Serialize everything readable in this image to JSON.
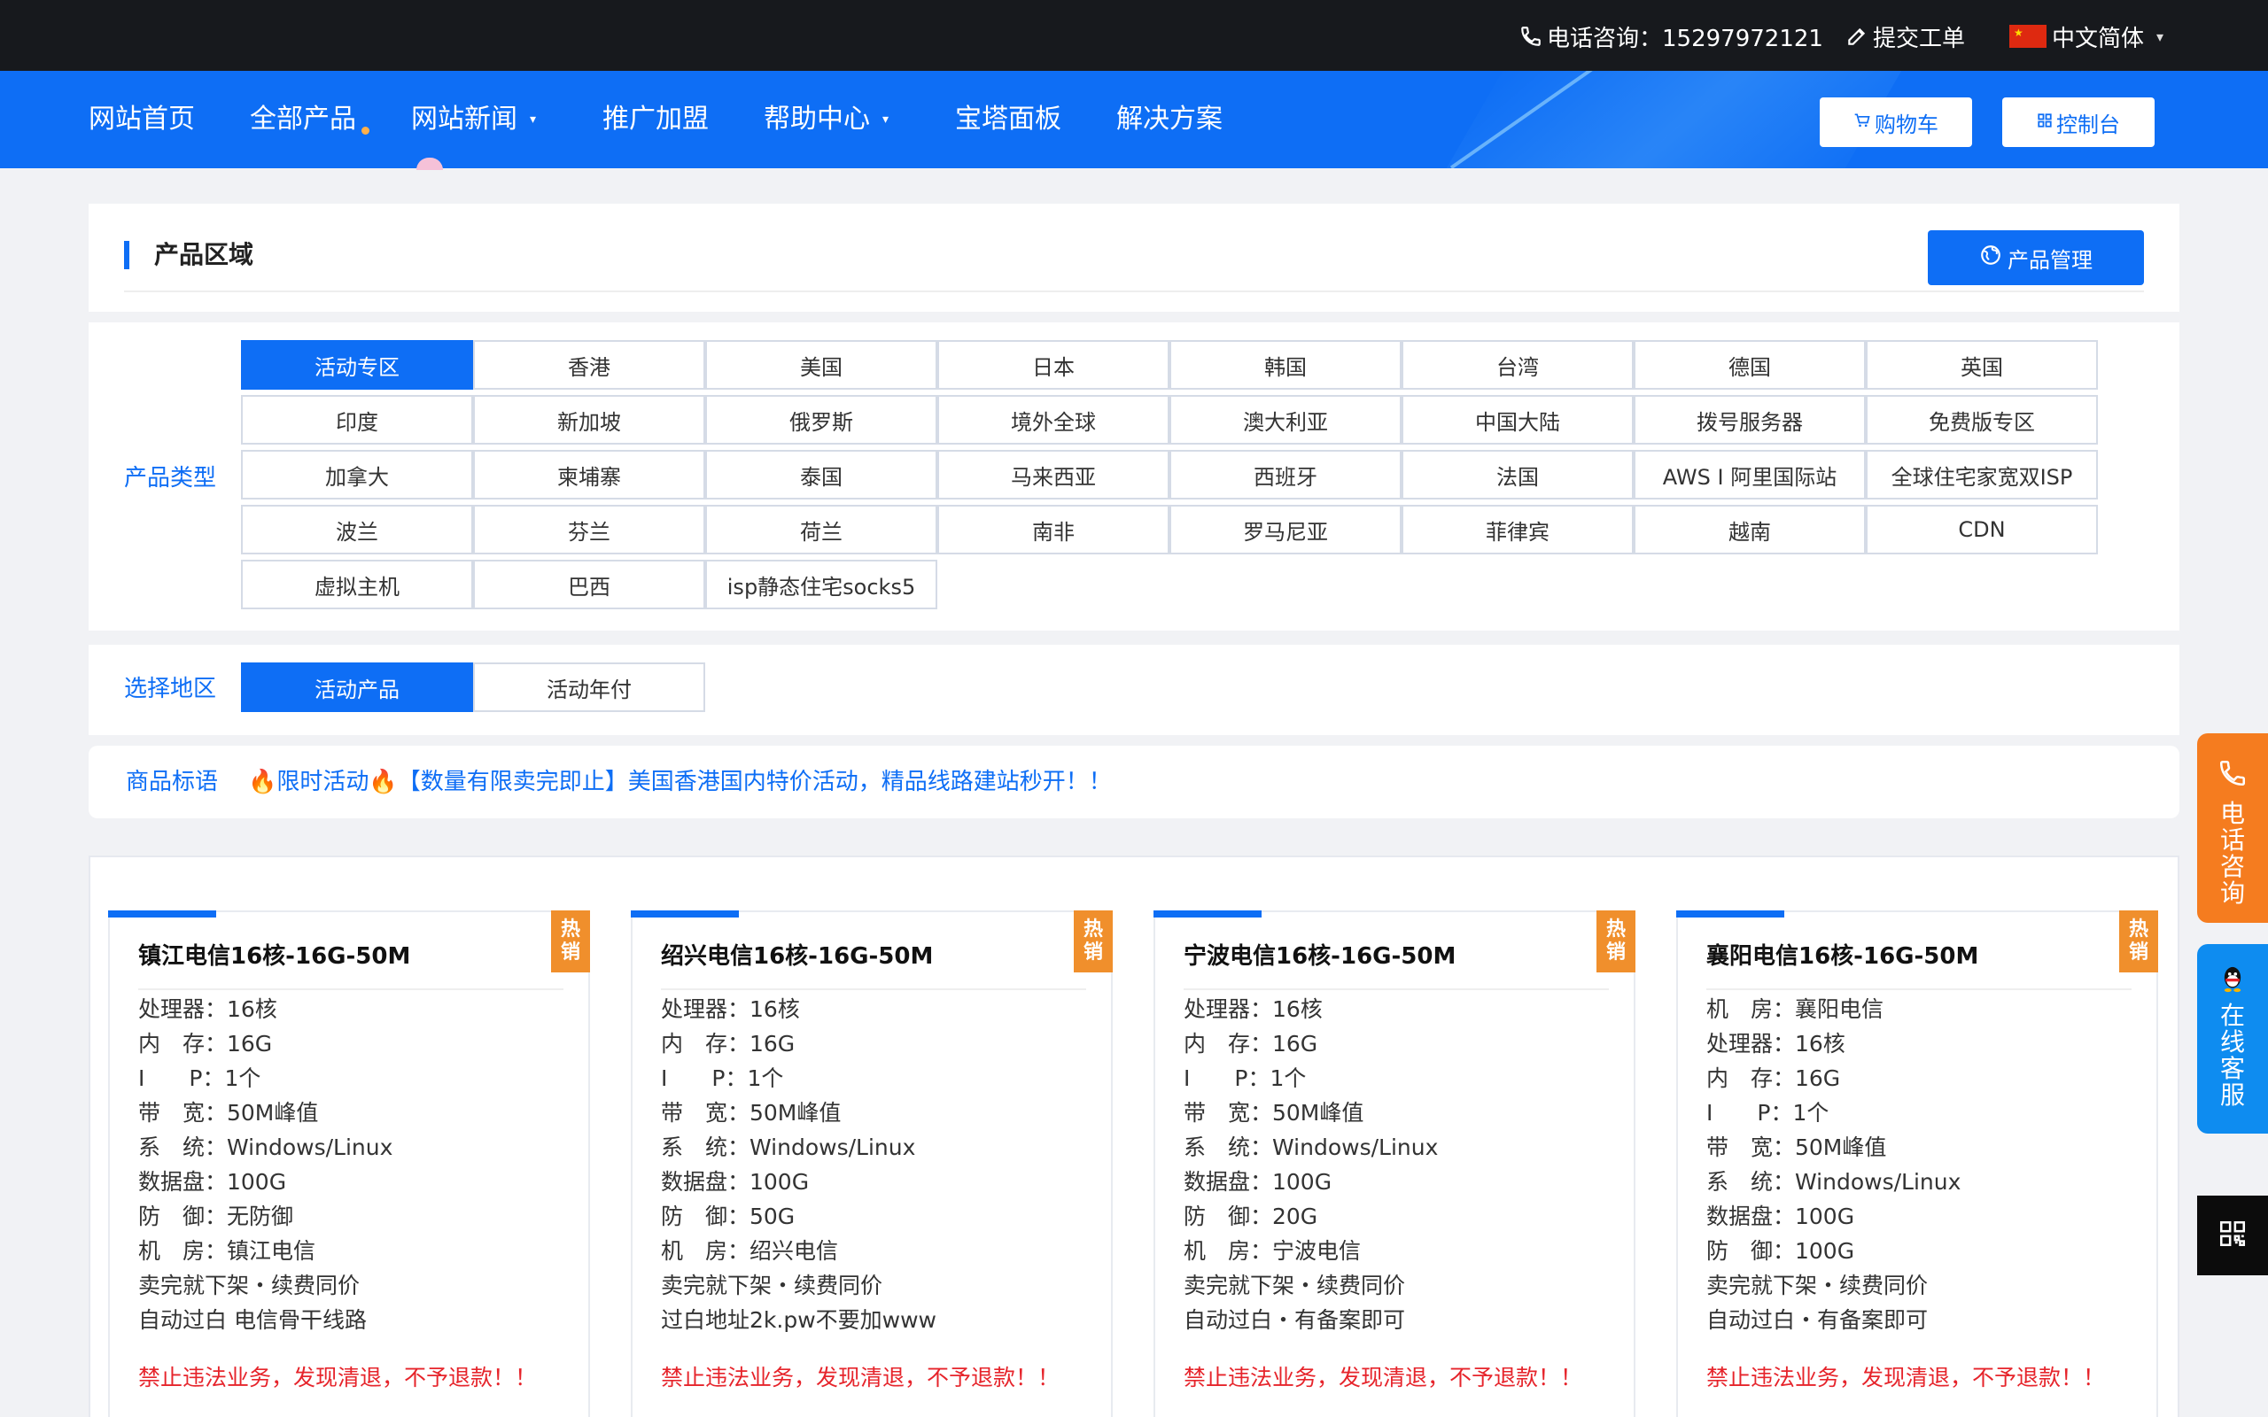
{
  "topbar": {
    "phone_label": "电话咨询：15297972121",
    "ticket_label": "提交工单",
    "language_label": "中文简体"
  },
  "nav": {
    "items": [
      {
        "label": "网站首页"
      },
      {
        "label": "全部产品"
      },
      {
        "label": "网站新闻"
      },
      {
        "label": "推广加盟"
      },
      {
        "label": "帮助中心"
      },
      {
        "label": "宝塔面板"
      },
      {
        "label": "解决方案"
      }
    ],
    "cart_label": "购物车",
    "console_label": "控制台"
  },
  "section": {
    "title": "产品区域",
    "manage_button": "产品管理"
  },
  "product_type": {
    "label": "产品类型",
    "options": [
      "活动专区",
      "香港",
      "美国",
      "日本",
      "韩国",
      "台湾",
      "德国",
      "英国",
      "印度",
      "新加坡",
      "俄罗斯",
      "境外全球",
      "澳大利亚",
      "中国大陆",
      "拨号服务器",
      "免费版专区",
      "加拿大",
      "柬埔寨",
      "泰国",
      "马来西亚",
      "西班牙",
      "法国",
      "AWS I 阿里国际站",
      "全球住宅家宽双ISP",
      "波兰",
      "芬兰",
      "荷兰",
      "南非",
      "罗马尼亚",
      "菲律宾",
      "越南",
      "CDN",
      "虚拟主机",
      "巴西",
      "isp静态住宅socks5"
    ],
    "selected": "活动专区"
  },
  "region": {
    "label": "选择地区",
    "options": [
      "活动产品",
      "活动年付"
    ],
    "selected": "活动产品"
  },
  "slogan": {
    "label": "商品标语",
    "fire": "🔥",
    "text1": "限时活动",
    "text2": "【数量有限卖完即止】美国香港国内特价活动，精品线路建站秒开！！"
  },
  "products": [
    {
      "badge": "热销",
      "title": "镇江电信16核-16G-50M",
      "specs": [
        "处理器：16核",
        "内　存：16G",
        "I　　P：1个",
        "带　宽：50M峰值",
        "系　统：Windows/Linux",
        "数据盘：100G",
        "防　御：无防御",
        "机　房：镇江电信",
        "卖完就下架・续费同价",
        "自动过白 电信骨干线路"
      ],
      "warning": "禁止违法业务，发现清退，不予退款！！"
    },
    {
      "badge": "热销",
      "title": "绍兴电信16核-16G-50M",
      "specs": [
        "处理器：16核",
        "内　存：16G",
        "I　　P：1个",
        "带　宽：50M峰值",
        "系　统：Windows/Linux",
        "数据盘：100G",
        "防　御：50G",
        "机　房：绍兴电信",
        "卖完就下架・续费同价",
        "过白地址2k.pw不要加www"
      ],
      "warning": "禁止违法业务，发现清退，不予退款！！"
    },
    {
      "badge": "热销",
      "title": "宁波电信16核-16G-50M",
      "specs": [
        "处理器：16核",
        "内　存：16G",
        "I　　P：1个",
        "带　宽：50M峰值",
        "系　统：Windows/Linux",
        "数据盘：100G",
        "防　御：20G",
        "机　房：宁波电信",
        "卖完就下架・续费同价",
        "自动过白・有备案即可"
      ],
      "warning": "禁止违法业务，发现清退，不予退款！！"
    },
    {
      "badge": "热销",
      "title": "襄阳电信16核-16G-50M",
      "specs": [
        "机　房：襄阳电信",
        "处理器：16核",
        "内　存：16G",
        "I　　P：1个",
        "带　宽：50M峰值",
        "系　统：Windows/Linux",
        "数据盘：100G",
        "防　御：100G",
        "卖完就下架・续费同价",
        "自动过白・有备案即可"
      ],
      "warning": "禁止违法业务，发现清退，不予退款！！"
    }
  ],
  "side": {
    "phone_label": "电话咨询",
    "qq_label": "在线客服"
  },
  "colors": {
    "primary": "#0e6ef5",
    "topbar": "#17191d",
    "hot_badge": "#f08f2c",
    "warning": "#e6242b",
    "side_phone": "#f57c1f",
    "side_qq": "#0e8cf0"
  }
}
